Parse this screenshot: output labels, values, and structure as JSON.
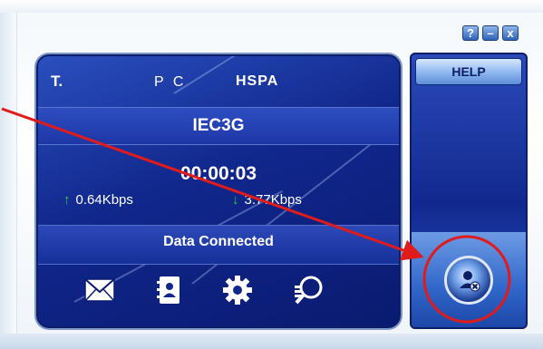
{
  "window": {
    "title_buttons": [
      {
        "label": "?",
        "icon": "help-icon"
      },
      {
        "label": "–",
        "icon": "minimize-icon"
      },
      {
        "label": "x",
        "icon": "close-icon"
      }
    ]
  },
  "status_bar": {
    "signal_label": "T.",
    "mode": "P C",
    "network": "HSPA"
  },
  "carrier": "IEC3G",
  "connection": {
    "timer": "00:00:03",
    "upload_rate": "0.64Kbps",
    "download_rate": "3.77Kbps",
    "status": "Data Connected"
  },
  "toolbar": {
    "items": [
      {
        "name": "sms",
        "icon": "envelope-icon"
      },
      {
        "name": "phonebook",
        "icon": "address-book-icon"
      },
      {
        "name": "settings",
        "icon": "gear-icon"
      },
      {
        "name": "diagnostics",
        "icon": "network-search-icon"
      }
    ]
  },
  "right_panel": {
    "help_label": "HELP",
    "connect_icon": "disconnect-icon"
  },
  "colors": {
    "panel_blue": "#10278c",
    "annotation_red": "#e01b1b",
    "arrow_green": "#2fd03a"
  }
}
